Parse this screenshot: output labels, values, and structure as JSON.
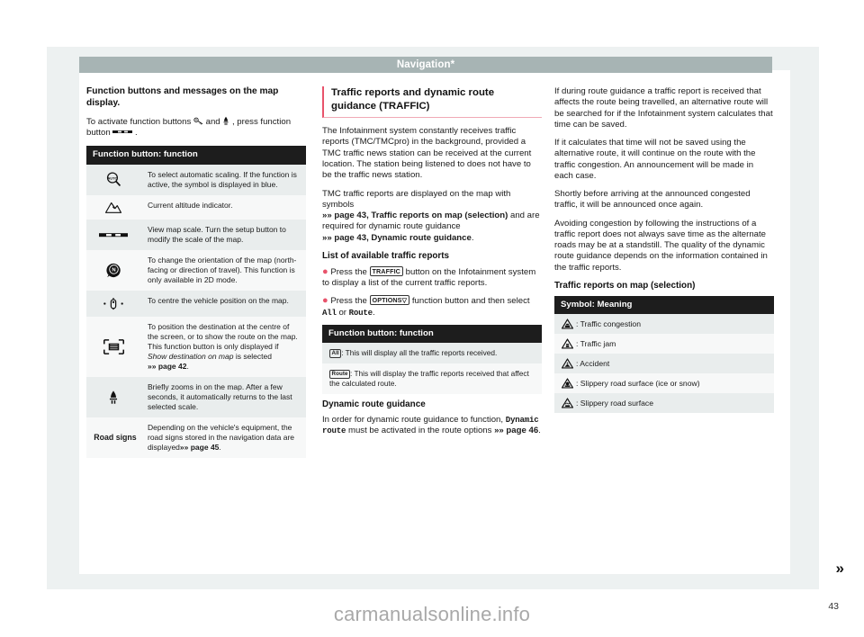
{
  "running_head": {
    "title": "Navigation*"
  },
  "folio": {
    "page_number": "43"
  },
  "watermark": {
    "text": "carmanualsonline.info"
  },
  "turn_arrow": "»",
  "column_left": {
    "heading": "Function buttons and messages on the map display.",
    "intro_pre": "To activate function buttons",
    "intro_mid": "and",
    "intro_post": ", press function button",
    "intro_end": ".",
    "table": {
      "header": "Function button: function",
      "rows": [
        {
          "icon": "auto-scale-icon",
          "label": "",
          "text": "To select automatic scaling. If the function is active, the symbol is displayed in blue."
        },
        {
          "icon": "altitude-mountain-icon",
          "label": "",
          "text": "Current altitude indicator."
        },
        {
          "icon": "map-scale-bar-icon",
          "label": "",
          "text": "View map scale. Turn the setup button to modify the scale of the map."
        },
        {
          "icon": "compass-north-icon",
          "label": "",
          "text": "To change the orientation of the map (north-facing or direction of travel). This function is only available in 2D mode."
        },
        {
          "icon": "centre-vehicle-icon",
          "label": "",
          "text": "To centre the vehicle position on the map."
        },
        {
          "icon": "destination-frame-icon",
          "label": "",
          "text_pre": "To position the destination at the centre of the screen, or to show the route on the map. This function button is only displayed if ",
          "text_italic": "Show destination on map",
          "text_post": " is selected ",
          "ref": "»» page 42",
          "text_end": "."
        },
        {
          "icon": "zoom-briefly-icon",
          "label": "",
          "text": "Briefly zooms in on the map. After a few seconds, it automatically returns to the last selected scale."
        },
        {
          "icon": "",
          "label": "Road signs",
          "text_pre": "Depending on the vehicle's equipment, the road signs stored in the navigation data are displayed",
          "ref": "»» page 45",
          "text_end": "."
        }
      ]
    }
  },
  "column_middle": {
    "title": "Traffic reports and dynamic route guidance (TRAFFIC)",
    "para_1": "The Infotainment system constantly receives traffic reports (TMC/TMCpro) in the background, provided a TMC traffic news station can be received at the current location. The station being listened to does not have to be the traffic news station.",
    "para_2_pre": "TMC traffic reports are displayed on the map with symbols ",
    "para_2_ref1": "»» page 43, Traffic reports on map (selection)",
    "para_2_mid": " and are required for dynamic route guidance ",
    "para_2_ref2": "»» page 43, Dynamic route guidance",
    "para_2_end": ".",
    "subheading_list": "List of available traffic reports",
    "bullet_1_pre": "Press the",
    "bullet_1_key": "TRAFFIC",
    "bullet_1_post": "button on the Infotainment system to display a list of the current traffic reports.",
    "bullet_2_pre": "Press the",
    "bullet_2_key": "OPTIONS▽",
    "bullet_2_mid": "function button and then select",
    "bullet_2_opt1": "All",
    "bullet_2_or": "or",
    "bullet_2_opt2": "Route",
    "bullet_2_end": ".",
    "table": {
      "header": "Function button: function",
      "rows": [
        {
          "key": "All",
          "text": ": This will display all the traffic reports received."
        },
        {
          "key": "Route",
          "text": ": This will display the traffic reports received that affect the calculated route."
        }
      ]
    },
    "subheading_dynamic": "Dynamic route guidance",
    "para_dynamic_pre": "In order for dynamic route guidance to function, ",
    "para_dynamic_mono": "Dynamic  route",
    "para_dynamic_mid": " must be activated in the route options ",
    "para_dynamic_ref": "»» page 46",
    "para_dynamic_end": "."
  },
  "column_right": {
    "para_1": "If during route guidance a traffic report is received that affects the route being travelled, an alternative route will be searched for if the Infotainment system calculates that time can be saved.",
    "para_2": "If it calculates that time will not be saved using the alternative route, it will continue on the route with the traffic congestion. An announcement will be made in each case.",
    "para_3": "Shortly before arriving at the announced congested traffic, it will be announced once again.",
    "para_4": "Avoiding congestion by following the instructions of a traffic report does not always save time as the alternate roads may be at a standstill. The quality of the dynamic route guidance depends on the information contained in the traffic reports.",
    "subheading": "Traffic reports on map (selection)",
    "table": {
      "header": "Symbol: Meaning",
      "rows": [
        {
          "icon": "warning-triangle-congestion-icon",
          "text": ": Traffic congestion"
        },
        {
          "icon": "warning-triangle-jam-icon",
          "text": ": Traffic jam"
        },
        {
          "icon": "warning-triangle-accident-icon",
          "text": ": Accident"
        },
        {
          "icon": "warning-triangle-ice-icon",
          "text": ": Slippery road surface (ice or snow)"
        },
        {
          "icon": "warning-triangle-slippery-icon",
          "text": ": Slippery road surface"
        }
      ]
    }
  },
  "colors": {
    "running_head_bg": "#a7b4b4",
    "table_header_bg": "#1d1d1d",
    "row_alt_bg": "#e9eded",
    "row_plain_bg": "#f7f8f8",
    "accent_red": "#e8536b",
    "page_backdrop": "#edf1f1"
  }
}
